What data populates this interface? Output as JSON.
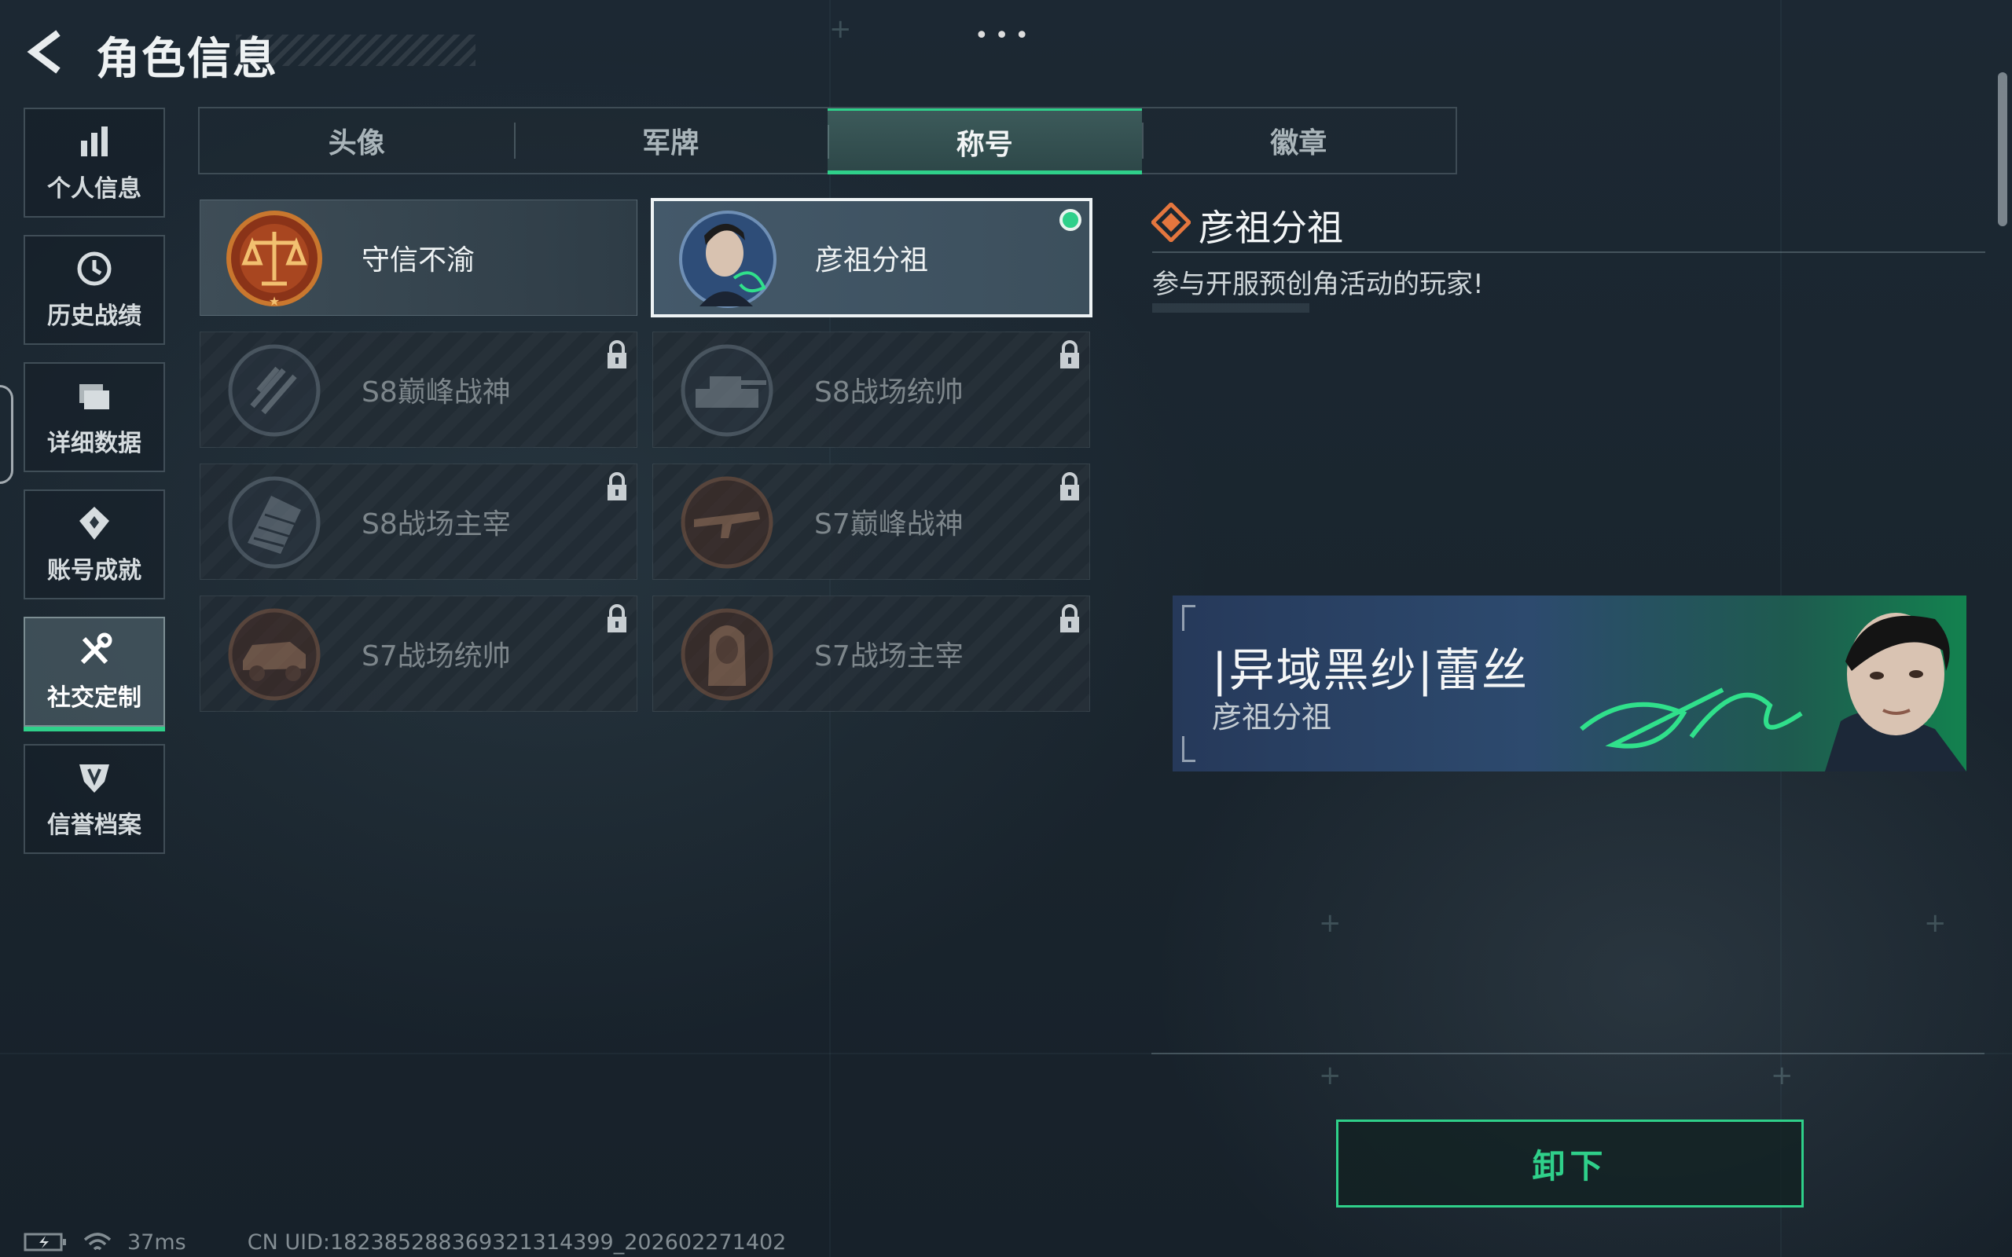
{
  "header": {
    "title": "角色信息",
    "more_dots": "•••"
  },
  "sidebar": {
    "items": [
      {
        "label": "个人信息",
        "icon": "bar-chart-icon"
      },
      {
        "label": "历史战绩",
        "icon": "history-clock-icon"
      },
      {
        "label": "详细数据",
        "icon": "folder-icon"
      },
      {
        "label": "账号成就",
        "icon": "achievement-icon"
      },
      {
        "label": "社交定制",
        "icon": "tools-icon",
        "active": true
      },
      {
        "label": "信誉档案",
        "icon": "credit-badge-icon"
      }
    ]
  },
  "tabs": [
    {
      "label": "头像"
    },
    {
      "label": "军牌"
    },
    {
      "label": "称号",
      "active": true
    },
    {
      "label": "徽章"
    }
  ],
  "titles": [
    {
      "name": "守信不渝",
      "emblem": "scales-emblem",
      "locked": false
    },
    {
      "name": "彦祖分祖",
      "emblem": "portrait-emblem",
      "locked": false,
      "selected": true
    },
    {
      "name": "S8巅峰战神",
      "emblem": "s8-peak-emblem",
      "locked": true
    },
    {
      "name": "S8战场统帅",
      "emblem": "tank-emblem",
      "locked": true
    },
    {
      "name": "S8战场主宰",
      "emblem": "building-emblem",
      "locked": true
    },
    {
      "name": "S7巅峰战神",
      "emblem": "rifle-emblem",
      "locked": true
    },
    {
      "name": "S7战场统帅",
      "emblem": "vehicle-emblem",
      "locked": true
    },
    {
      "name": "S7战场主宰",
      "emblem": "sphinx-emblem",
      "locked": true
    }
  ],
  "detail": {
    "title": "彦祖分祖",
    "description": "参与开服预创角活动的玩家!",
    "banner": {
      "player_name": "|异域黑纱|蕾丝",
      "title_name": "彦祖分祖"
    },
    "action_button": "卸下"
  },
  "status_bar": {
    "ping": "37ms",
    "uid": "CN UID:1823852883693213143​99_202602271402"
  },
  "colors": {
    "accent": "#2fd08a",
    "background": "#1c2833",
    "locked_text": "#7d868b"
  }
}
